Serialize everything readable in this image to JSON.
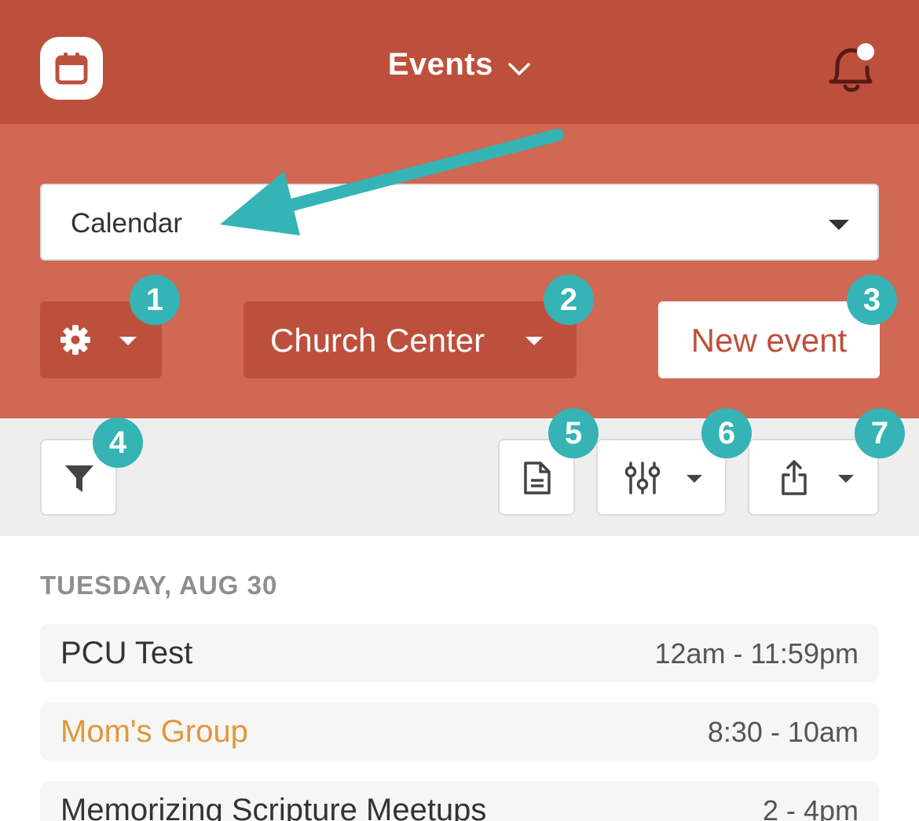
{
  "header": {
    "title": "Events",
    "logo_icon": "calendar-icon",
    "notification_icon": "bell-icon",
    "brand_color": "#bd503c"
  },
  "calendar_select": {
    "value": "Calendar"
  },
  "actions": {
    "settings_icon": "gear-icon",
    "church_center_label": "Church Center",
    "new_event_label": "New event"
  },
  "badges": [
    "1",
    "2",
    "3",
    "4",
    "5",
    "6",
    "7"
  ],
  "badge_color": "#35b3b5",
  "toolbar": {
    "filter_icon": "filter-icon",
    "document_icon": "document-icon",
    "columns_icon": "sliders-icon",
    "export_icon": "share-icon"
  },
  "schedule": {
    "day_heading": "TUESDAY, AUG 30",
    "events": [
      {
        "name": "PCU Test",
        "time": "12am - 11:59pm",
        "color": "#333333"
      },
      {
        "name": "Mom's Group",
        "time": "8:30 - 10am",
        "color": "#e0983a"
      },
      {
        "name": "Memorizing Scripture Meetups",
        "time": "2 - 4pm",
        "color": "#333333"
      }
    ]
  }
}
